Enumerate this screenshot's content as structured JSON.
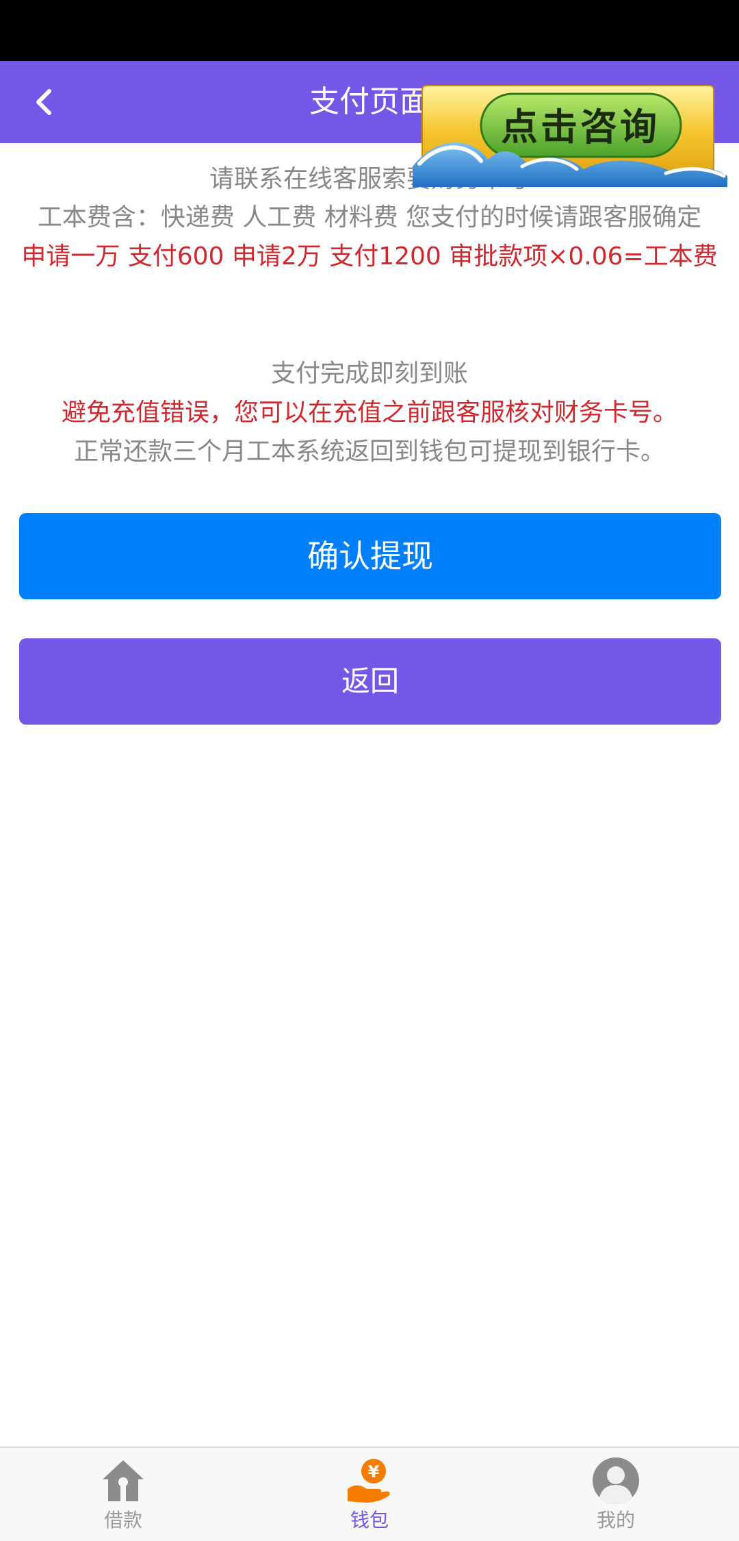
{
  "header": {
    "title": "支付页面"
  },
  "consult_banner": {
    "text": "点击咨询"
  },
  "info": {
    "line1": "请联系在线客服索要财务卡号",
    "line2": "工本费含：快递费 人工费 材料费 您支付的时候请跟客服确定",
    "line3": "申请一万 支付600  申请2万 支付1200 审批款项×0.06=工本费",
    "line4": "支付完成即刻到账",
    "line5": "避免充值错误，您可以在充值之前跟客服核对财务卡号。",
    "line6": "正常还款三个月工本系统返回到钱包可提现到银行卡。"
  },
  "buttons": {
    "confirm_label": "确认提现",
    "back_label": "返回"
  },
  "tabbar": {
    "items": [
      {
        "label": "借款",
        "icon": "house-icon",
        "active": false
      },
      {
        "label": "钱包",
        "icon": "wallet-icon",
        "active": true
      },
      {
        "label": "我的",
        "icon": "user-icon",
        "active": false
      }
    ]
  },
  "colors": {
    "header_bg": "#7557e8",
    "confirm_bg": "#0080fc",
    "back_bg": "#7557e8",
    "warning_text": "#d0282f",
    "muted_text": "#888888",
    "active_tab_icon": "#f57c00"
  }
}
